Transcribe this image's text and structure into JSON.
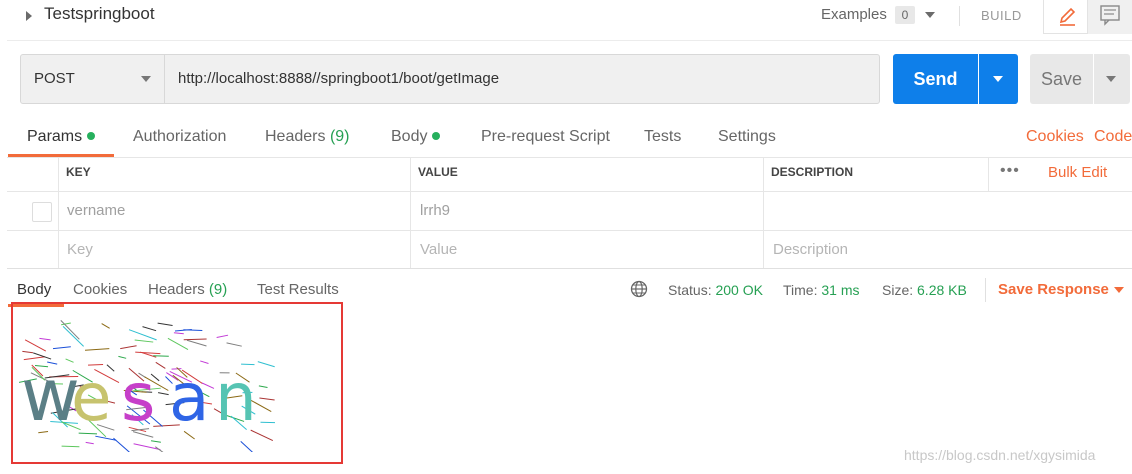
{
  "header": {
    "collection_title": "Testspringboot",
    "examples_label": "Examples",
    "examples_count": "0",
    "build_label": "BUILD"
  },
  "request": {
    "method": "POST",
    "url": "http://localhost:8888//springboot1/boot/getImage",
    "send_label": "Send",
    "save_label": "Save"
  },
  "request_tabs": {
    "params": "Params",
    "authorization": "Authorization",
    "headers": "Headers",
    "headers_count": "(9)",
    "body": "Body",
    "prerequest": "Pre-request Script",
    "tests": "Tests",
    "settings": "Settings",
    "cookies": "Cookies",
    "code": "Code"
  },
  "params_table": {
    "col_key": "KEY",
    "col_value": "VALUE",
    "col_description": "DESCRIPTION",
    "bulk_edit": "Bulk Edit",
    "more": "•••",
    "rows": [
      {
        "key": "vername",
        "value": "lrrh9",
        "description": ""
      }
    ],
    "placeholder_key": "Key",
    "placeholder_value": "Value",
    "placeholder_description": "Description"
  },
  "response_tabs": {
    "body": "Body",
    "cookies": "Cookies",
    "headers": "Headers",
    "headers_count": "(9)",
    "test_results": "Test Results"
  },
  "response_status": {
    "status_label": "Status:",
    "status_value": "200 OK",
    "time_label": "Time:",
    "time_value": "31 ms",
    "size_label": "Size:",
    "size_value": "6.28 KB",
    "save_response": "Save Response"
  },
  "captcha": {
    "letters": [
      "w",
      "e",
      "s",
      "a",
      "n"
    ],
    "colors": [
      "#5b7f86",
      "#c7c36e",
      "#c63fc9",
      "#2f65e6",
      "#56c4b3"
    ]
  },
  "colors": {
    "accent": "#f26b3a",
    "send": "#0e7fea",
    "success": "#26a053",
    "highlight_box": "#e53935"
  },
  "watermark": "https://blog.csdn.net/xgysimida"
}
